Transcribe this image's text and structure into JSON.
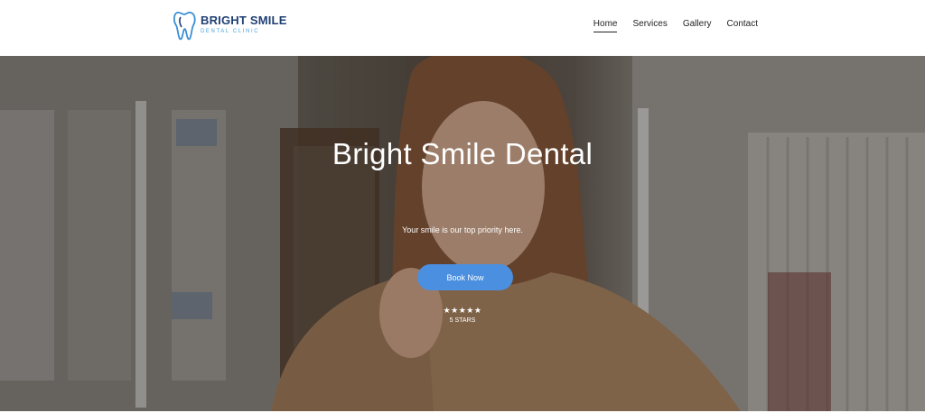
{
  "brand": {
    "name": "BRIGHT SMILE",
    "tagline": "DENTAL CLINIC",
    "icon": "tooth-icon",
    "primary_color": "#1f3f74",
    "accent_color": "#4aa3df"
  },
  "nav": {
    "items": [
      {
        "label": "Home",
        "active": true
      },
      {
        "label": "Services",
        "active": false
      },
      {
        "label": "Gallery",
        "active": false
      },
      {
        "label": "Contact",
        "active": false
      }
    ]
  },
  "hero": {
    "title": "Bright Smile Dental",
    "subtitle": "Your smile is our top priority here.",
    "cta_label": "Book Now",
    "cta_color": "#4a8fe0",
    "rating_stars": "★★★★★",
    "rating_label": "5 STARS",
    "rating_value": 5,
    "background_image": "woman with toothache in a clinic hallway"
  }
}
